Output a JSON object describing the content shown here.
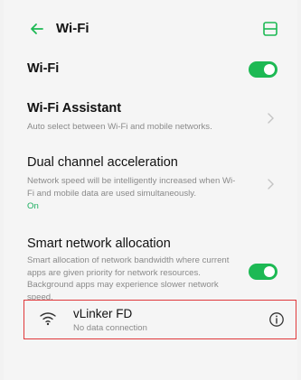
{
  "header": {
    "title": "Wi-Fi",
    "back_icon": "arrow-left-icon",
    "qr_icon": "qr-scan-icon",
    "accent_color": "#1db954"
  },
  "rows": {
    "wifi": {
      "title": "Wi-Fi",
      "toggle_on": true
    },
    "wifi_assistant": {
      "title": "Wi-Fi Assistant",
      "description": "Auto select between Wi-Fi and mobile networks."
    },
    "dual_channel": {
      "title": "Dual channel acceleration",
      "description": "Network speed will be intelligently increased when Wi-Fi and mobile data are used simultaneously.",
      "status": "On"
    },
    "smart_allocation": {
      "title": "Smart network allocation",
      "description": "Smart allocation of network bandwidth where current apps are given priority for network resources. Background apps may experience slower network speed.",
      "toggle_on": true
    }
  },
  "connected_network": {
    "name": "vLinker FD",
    "status": "No data connection",
    "highlight_color": "#e0383a"
  }
}
